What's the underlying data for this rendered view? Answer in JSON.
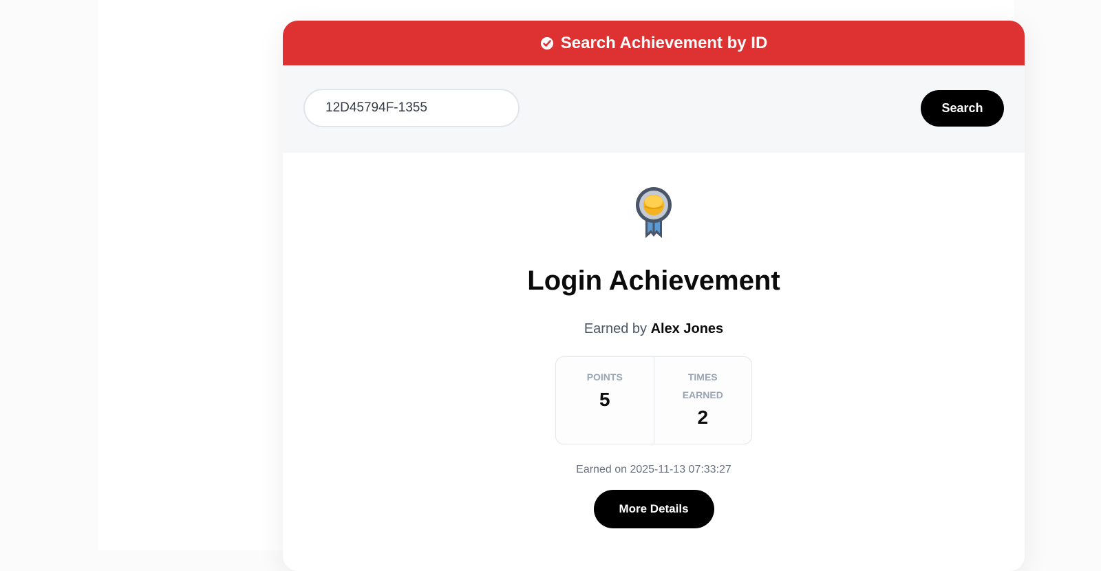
{
  "header": {
    "title": "Search Achievement by ID",
    "icon": "check-badge-icon"
  },
  "search": {
    "value": "12D45794F-1355",
    "button_label": "Search"
  },
  "achievement": {
    "icon": "medal-icon",
    "title": "Login Achievement",
    "earned_by_prefix": "Earned by",
    "earned_by_name": "Alex Jones",
    "stats": [
      {
        "label": "Points",
        "value": "5"
      },
      {
        "label": "Times Earned",
        "value": "2"
      }
    ],
    "earned_on": "Earned on 2025-11-13 07:33:27",
    "details_button_label": "More Details"
  },
  "colors": {
    "header_bg": "#de3232",
    "button_bg": "#000000",
    "medal_gold": "#f5b21f",
    "ribbon_blue": "#5b9bd5"
  }
}
